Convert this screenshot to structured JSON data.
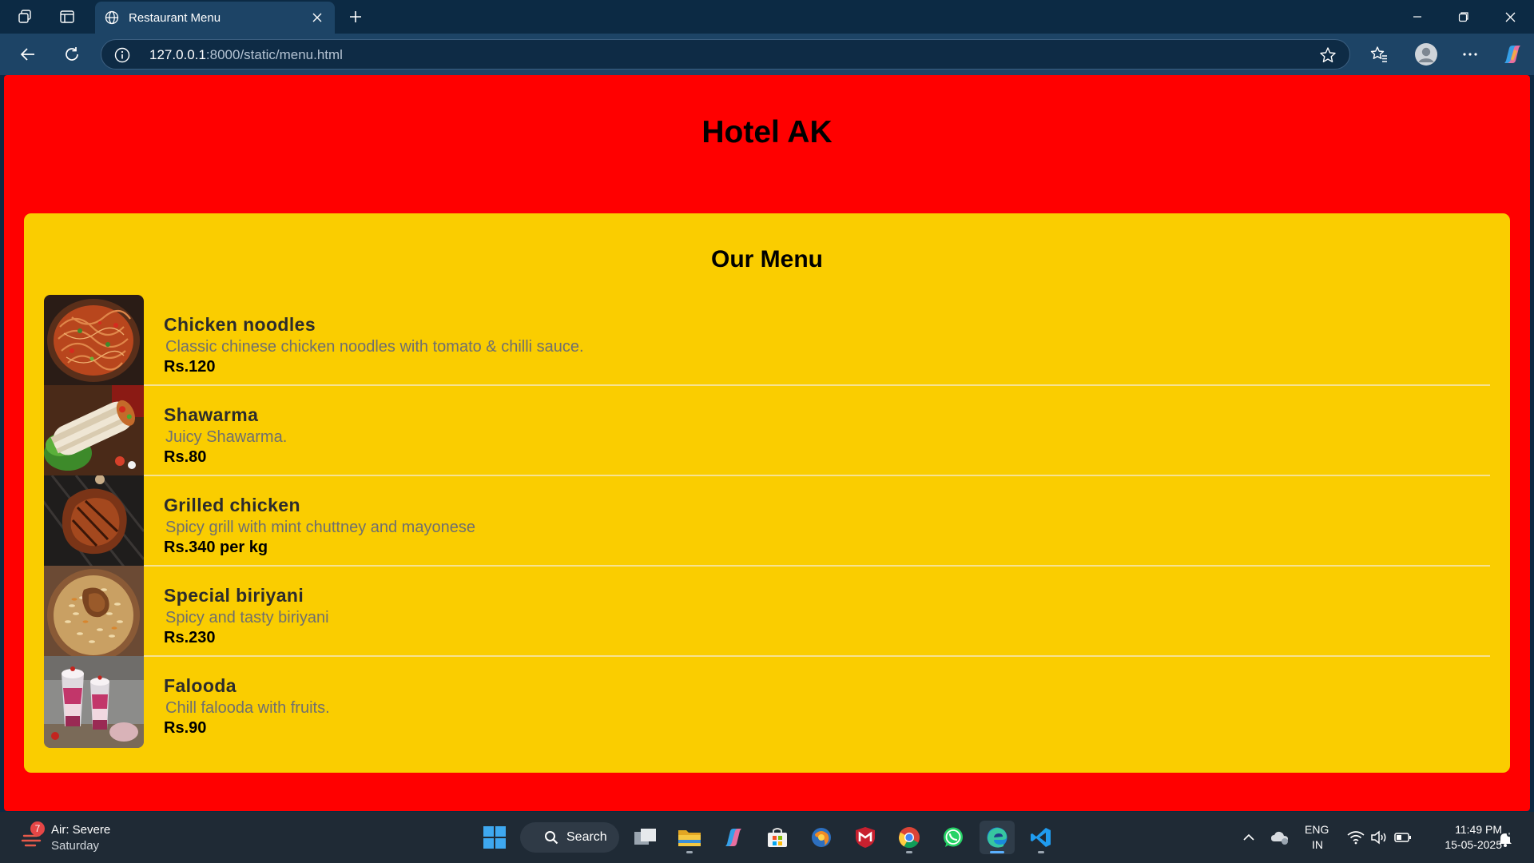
{
  "browser": {
    "tab_title": "Restaurant Menu",
    "url_host": "127.0.0.1",
    "url_path": ":8000/static/menu.html"
  },
  "page": {
    "site_title": "Hotel AK",
    "menu_title": "Our Menu",
    "items": [
      {
        "name": "Chicken noodles",
        "description": "Classic chinese chicken noodles with tomato & chilli sauce.",
        "price": "Rs.120"
      },
      {
        "name": "Shawarma",
        "description": "Juicy Shawarma.",
        "price": "Rs.80"
      },
      {
        "name": "Grilled chicken",
        "description": "Spicy grill with mint chuttney and mayonese",
        "price": "Rs.340 per kg"
      },
      {
        "name": "Special biriyani",
        "description": "Spicy and tasty biriyani",
        "price": "Rs.230"
      },
      {
        "name": "Falooda",
        "description": "Chill falooda with fruits.",
        "price": "Rs.90"
      }
    ]
  },
  "taskbar": {
    "weather_badge": "7",
    "weather_title": "Air: Severe",
    "weather_day": "Saturday",
    "search_label": "Search",
    "lang_1": "ENG",
    "lang_2": "IN",
    "time": "11:49 PM",
    "date": "15-05-2025"
  },
  "colors": {
    "page_bg": "#ff0000",
    "menu_bg": "#facd00",
    "chrome_dark": "#0c2a44",
    "chrome_toolbar": "#1d4466",
    "taskbar": "#1f2a35"
  }
}
